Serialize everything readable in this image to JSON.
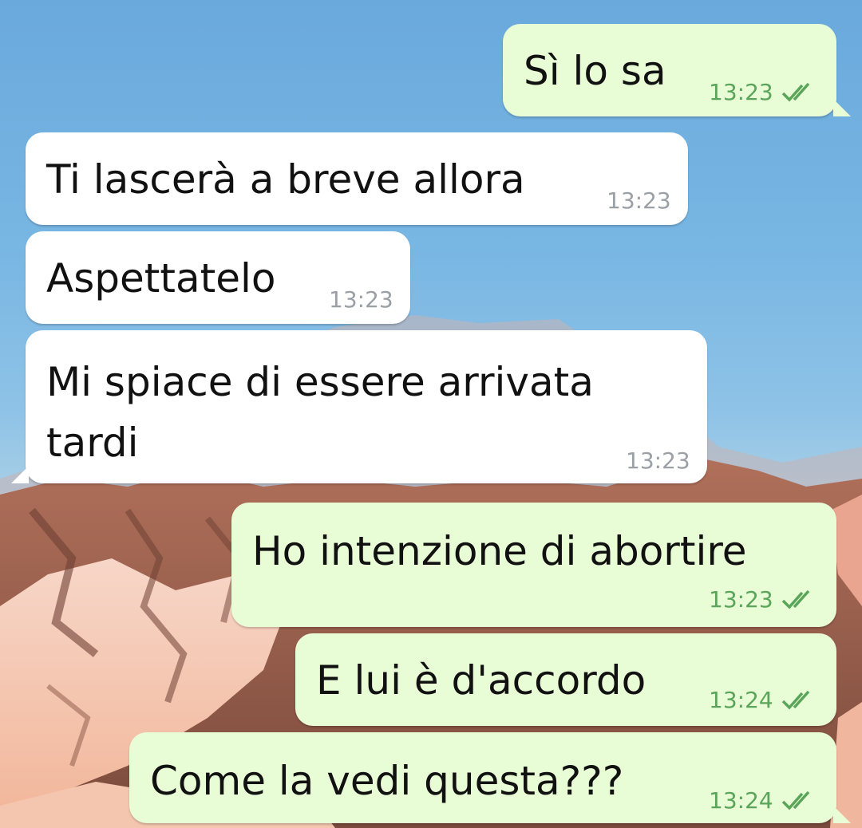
{
  "messages": [
    {
      "text": "Sì lo sa",
      "time": "13:23",
      "dir": "out",
      "read": true
    },
    {
      "text": "Ti lascerà a breve allora",
      "time": "13:23",
      "dir": "in"
    },
    {
      "text": "Aspettatelo",
      "time": "13:23",
      "dir": "in"
    },
    {
      "text": "Mi spiace di essere arrivata",
      "text2": "tardi",
      "time": "13:23",
      "dir": "in"
    },
    {
      "text": "Ho intenzione di abortire",
      "time": "13:23",
      "dir": "out",
      "read": true
    },
    {
      "text": "E lui è d'accordo",
      "time": "13:24",
      "dir": "out",
      "read": true
    },
    {
      "text": "Come la vedi questa???",
      "time": "13:24",
      "dir": "out",
      "read": true
    }
  ],
  "colors": {
    "incoming_bubble": "#ffffff",
    "outgoing_bubble": "#e8fdd6",
    "read_ticks": "#5aa55a",
    "timestamp_incoming": "#9aa0a6"
  },
  "icons": {
    "read_receipt": "double-check-icon"
  }
}
